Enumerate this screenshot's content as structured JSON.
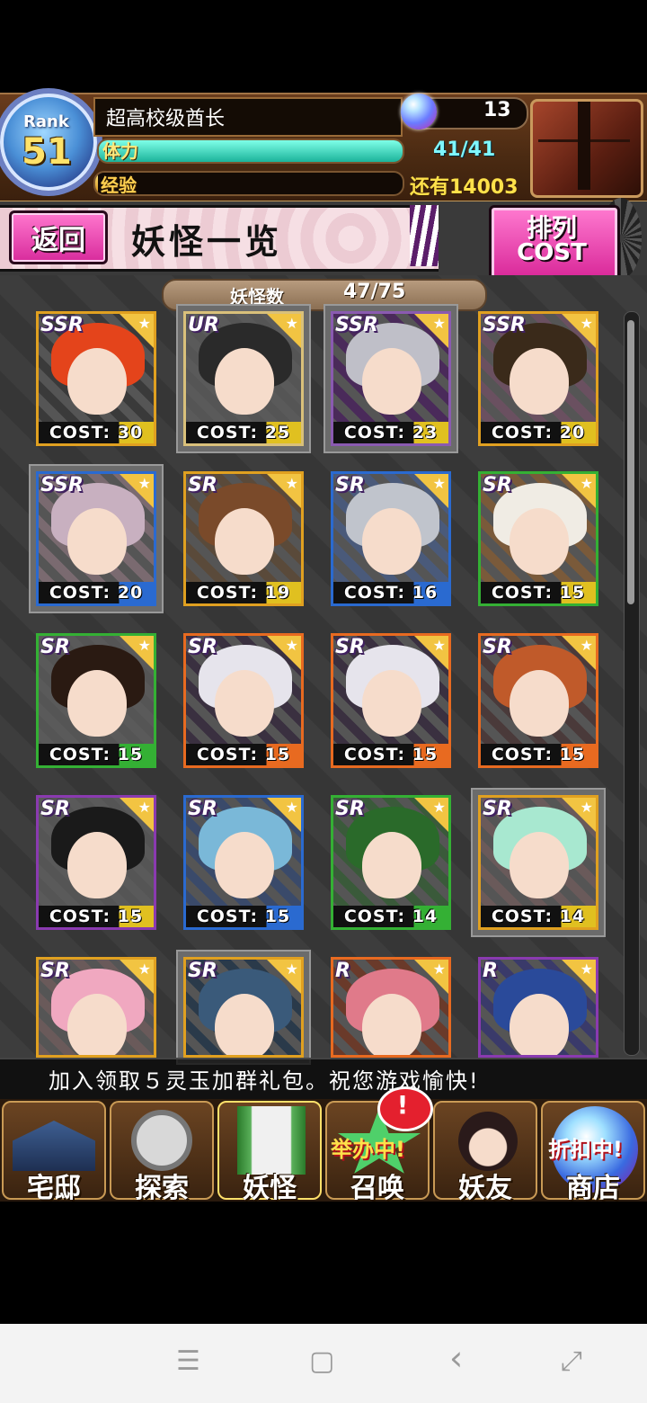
{
  "header": {
    "rank_label": "Rank",
    "rank_value": "51",
    "player_name": "超高校级酋长",
    "gem_count": "13",
    "stamina_label": "体力",
    "stamina_value": "41/41",
    "stamina_fraction": 1.0,
    "exp_label": "经验",
    "exp_remaining": "还有14003",
    "exp_fraction": 0.01
  },
  "titlebar": {
    "back_label": "返回",
    "title": "妖怪一览",
    "sort_label": "排列",
    "sort_value": "COST"
  },
  "roster": {
    "count_label": "妖怪数",
    "count_value": "47/75",
    "cards": [
      {
        "rarity": "SSR",
        "cost": "COST: 30",
        "frame": "#e0a020",
        "hair": "#e4441b",
        "bg": "#3a3a3a",
        "bar": "#e0c020"
      },
      {
        "rarity": "UR",
        "cost": "COST: 25",
        "frame": "#d9c07a",
        "hair": "#2a2a2a",
        "bg": "#5a5a5a",
        "bar": "#e0c020"
      },
      {
        "rarity": "SSR",
        "cost": "COST: 23",
        "frame": "#8a5ab0",
        "hair": "#bfbfc8",
        "bg": "#4a2a5a",
        "bar": "#e0c020"
      },
      {
        "rarity": "SSR",
        "cost": "COST: 20",
        "frame": "#e0a020",
        "hair": "#3a2a1a",
        "bg": "#6a5060",
        "bar": "#e0c020"
      },
      {
        "rarity": "SSR",
        "cost": "COST: 20",
        "frame": "#2a6ad0",
        "hair": "#c8b0c0",
        "bg": "#7a6a70",
        "bar": "#2a6ad0"
      },
      {
        "rarity": "SR",
        "cost": "COST: 19",
        "frame": "#e0a020",
        "hair": "#7a4a2a",
        "bg": "#5a4a3a",
        "bar": "#e0c020"
      },
      {
        "rarity": "SR",
        "cost": "COST: 16",
        "frame": "#2a6ad0",
        "hair": "#c0c4cc",
        "bg": "#4a5a7a",
        "bar": "#2a6ad0"
      },
      {
        "rarity": "SR",
        "cost": "COST: 15",
        "frame": "#34b034",
        "hair": "#f0ece4",
        "bg": "#7a5a3a",
        "bar": "#e0c020"
      },
      {
        "rarity": "SR",
        "cost": "COST: 15",
        "frame": "#34b034",
        "hair": "#2a1a12",
        "bg": "#5a5a5a",
        "bar": "#34b034"
      },
      {
        "rarity": "SR",
        "cost": "COST: 15",
        "frame": "#e86a20",
        "hair": "#e6e4ec",
        "bg": "#3a3040",
        "bar": "#e86a20"
      },
      {
        "rarity": "SR",
        "cost": "COST: 15",
        "frame": "#e86a20",
        "hair": "#e6e4ec",
        "bg": "#3a3040",
        "bar": "#e86a20"
      },
      {
        "rarity": "SR",
        "cost": "COST: 15",
        "frame": "#e86a20",
        "hair": "#c05a2a",
        "bg": "#4a3a3a",
        "bar": "#e86a20"
      },
      {
        "rarity": "SR",
        "cost": "COST: 15",
        "frame": "#8a3ab0",
        "hair": "#1a1a1a",
        "bg": "#5a5a5a",
        "bar": "#e0c020"
      },
      {
        "rarity": "SR",
        "cost": "COST: 15",
        "frame": "#2a6ad0",
        "hair": "#7ab8d8",
        "bg": "#3a4a6a",
        "bar": "#2a6ad0"
      },
      {
        "rarity": "SR",
        "cost": "COST: 14",
        "frame": "#34b034",
        "hair": "#2a6a2a",
        "bg": "#3a5a3a",
        "bar": "#34b034"
      },
      {
        "rarity": "SR",
        "cost": "COST: 14",
        "frame": "#e0a020",
        "hair": "#a8e8d0",
        "bg": "#6a5a5a",
        "bar": "#e0c020"
      },
      {
        "rarity": "SR",
        "cost": "",
        "frame": "#e0a020",
        "hair": "#f0a8c0",
        "bg": "#6a5a5a",
        "bar": "#e0c020"
      },
      {
        "rarity": "SR",
        "cost": "",
        "frame": "#e0a020",
        "hair": "#3a5a7a",
        "bg": "#2a3a4a",
        "bar": "#e0c020"
      },
      {
        "rarity": "R",
        "cost": "",
        "frame": "#e86a20",
        "hair": "#e07a8a",
        "bg": "#6a3a2a",
        "bar": "#e86a20"
      },
      {
        "rarity": "R",
        "cost": "",
        "frame": "#8a3ab0",
        "hair": "#2a4a9a",
        "bg": "#3a3a6a",
        "bar": "#8a3ab0"
      }
    ]
  },
  "notice": "加入领取５灵玉加群礼包。祝您游戏愉快!",
  "nav": {
    "items": [
      "宅邸",
      "探索",
      "妖怪",
      "召唤",
      "妖友",
      "商店"
    ],
    "summon_badge": "!",
    "summon_event": "举办中!",
    "shop_event": "折扣中!"
  },
  "colors": {
    "pink_button": "#d92899",
    "stamina": "#1bb39a",
    "exp": "#d28b19",
    "header_wood": "#4a2a12"
  },
  "icons": {
    "gem": "gem-icon",
    "chest": "chest-icon",
    "nav_home": "house-icon",
    "nav_explore": "magnifier-icon",
    "nav_yokai": "scroll-icon",
    "nav_summon": "star-icon",
    "nav_friends": "catgirl-icon",
    "nav_shop": "orb-icon"
  },
  "android_nav": {
    "menu": "☰",
    "home": "▢",
    "back": "‹",
    "rotate": "⤢"
  }
}
